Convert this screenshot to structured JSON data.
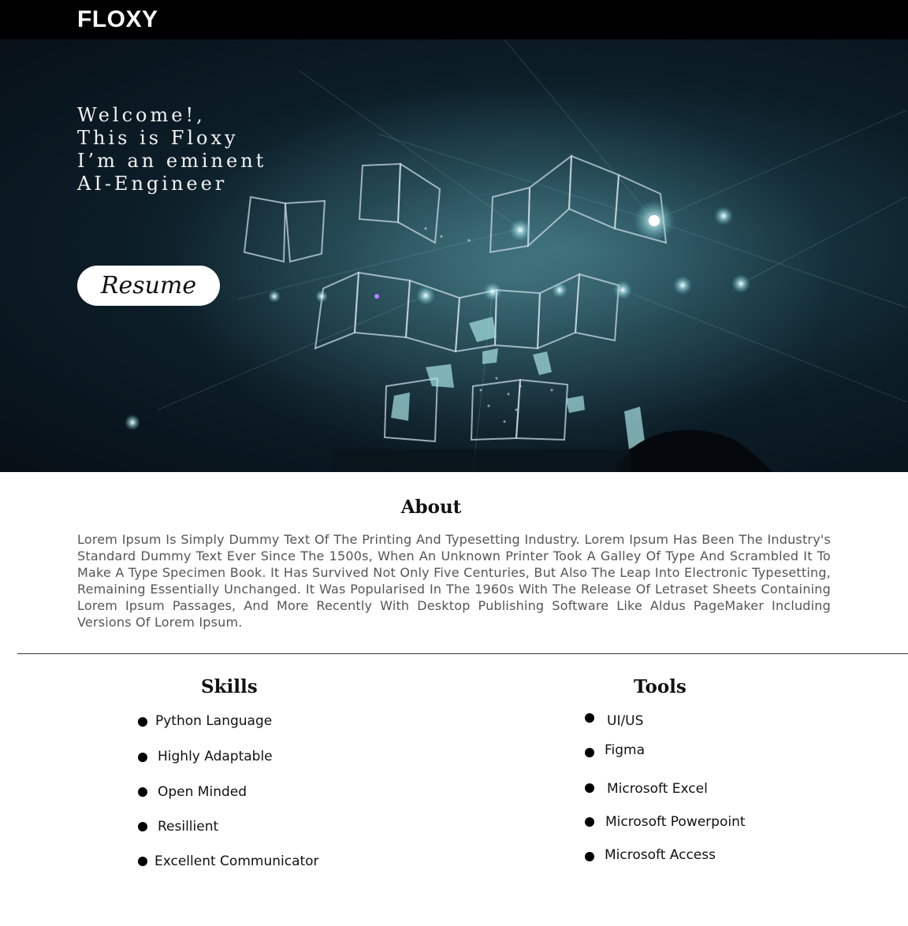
{
  "header": {
    "brand": "FLOXY"
  },
  "hero": {
    "lines": [
      "Welcome!,",
      "This is Floxy",
      "I’m an eminent",
      "AI-Engineer"
    ],
    "resume_label": "Resume"
  },
  "about": {
    "title": "About",
    "text": "Lorem Ipsum Is Simply Dummy Text Of The Printing And Typesetting Industry. Lorem Ipsum Has Been The Industry's Standard Dummy Text Ever Since The 1500s, When An Unknown Printer Took A Galley Of Type And Scrambled It To Make A Type Specimen Book. It Has Survived Not Only Five Centuries, But Also The Leap Into Electronic Typesetting, Remaining Essentially Unchanged. It Was Popularised In The 1960s With The Release Of Letraset Sheets Containing Lorem Ipsum Passages, And More Recently With Desktop Publishing Software Like Aldus PageMaker Including Versions Of Lorem Ipsum."
  },
  "skills": {
    "title": "Skills",
    "items": [
      "Python Language",
      "Highly Adaptable",
      "Open Minded",
      "Resillient",
      "Excellent Communicator"
    ]
  },
  "tools": {
    "title": "Tools",
    "items": [
      "UI/US",
      "Figma",
      "Microsoft Excel",
      "Microsoft Powerpoint",
      "Microsoft Access"
    ]
  },
  "colors": {
    "header_bg": "#000000",
    "hero_bg": "#0c1d27",
    "accent_light": "#e8f4f6"
  }
}
